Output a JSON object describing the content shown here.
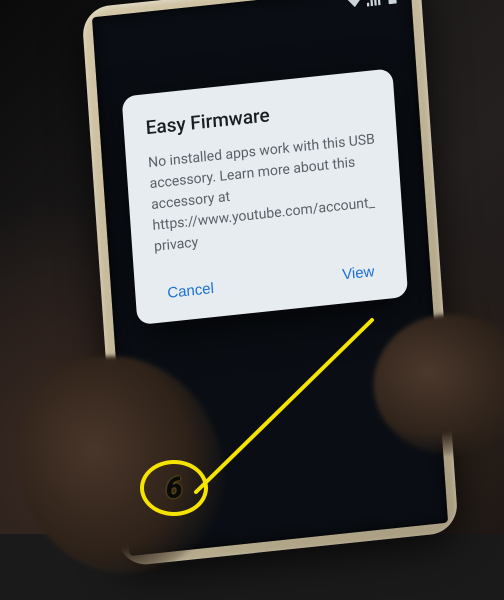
{
  "dialog": {
    "title": "Easy Firmware",
    "message": "No installed apps work with this USB accessory. Learn more about this accessory at https://www.youtube.com/account_privacy",
    "cancel_label": "Cancel",
    "view_label": "View"
  },
  "annotation": {
    "step_number": "6"
  }
}
